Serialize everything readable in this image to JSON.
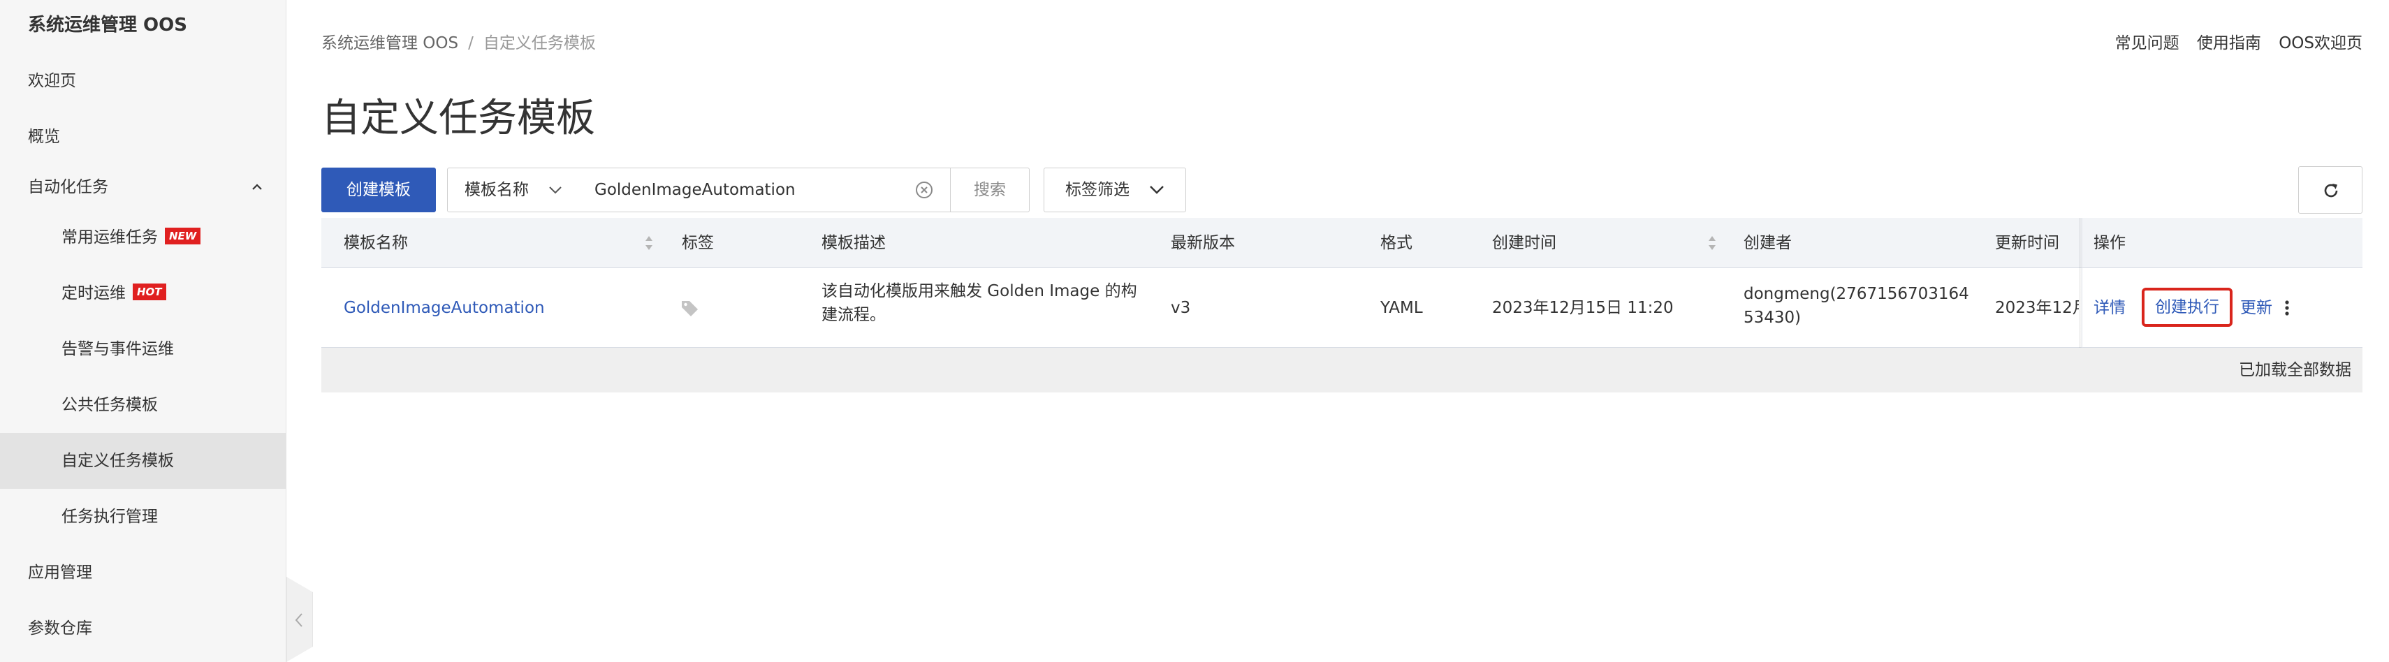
{
  "sidebar": {
    "title": "系统运维管理 OOS",
    "items": [
      {
        "label": "欢迎页"
      },
      {
        "label": "概览"
      },
      {
        "label": "自动化任务"
      },
      {
        "label": "常用运维任务",
        "badge": "NEW"
      },
      {
        "label": "定时运维",
        "badge": "HOT"
      },
      {
        "label": "告警与事件运维"
      },
      {
        "label": "公共任务模板"
      },
      {
        "label": "自定义任务模板"
      },
      {
        "label": "任务执行管理"
      },
      {
        "label": "应用管理"
      },
      {
        "label": "参数仓库"
      }
    ]
  },
  "breadcrumb": {
    "root": "系统运维管理 OOS",
    "separator": "/",
    "current": "自定义任务模板"
  },
  "top_links": [
    "常见问题",
    "使用指南",
    "OOS欢迎页"
  ],
  "page_title": "自定义任务模板",
  "toolbar": {
    "create_label": "创建模板",
    "field_select": "模板名称",
    "search_value": "GoldenImageAutomation",
    "search_label": "搜索",
    "tag_filter_label": "标签筛选"
  },
  "table": {
    "headers": {
      "name": "模板名称",
      "tags": "标签",
      "description": "模板描述",
      "version": "最新版本",
      "format": "格式",
      "created": "创建时间",
      "creator": "创建者",
      "updated": "更新时间",
      "actions": "操作"
    },
    "rows": [
      {
        "name": "GoldenImageAutomation",
        "description_line1": "该自动化模版用来触发 Golden Image 的构",
        "description_line2": "建流程。",
        "version": "v3",
        "format": "YAML",
        "created": "2023年12月15日 11:20",
        "creator_line1": "dongmeng(2767156703164",
        "creator_line2": "53430)",
        "updated": "2023年12月",
        "actions": {
          "details": "详情",
          "execute": "创建执行",
          "update": "更新"
        }
      }
    ],
    "footer": "已加载全部数据"
  },
  "colors": {
    "primary": "#2f5ab8",
    "highlight_border": "#d9251c",
    "badge": "#e02020",
    "sidebar_bg": "#f6f6f6",
    "header_bg": "#f2f4f7"
  }
}
